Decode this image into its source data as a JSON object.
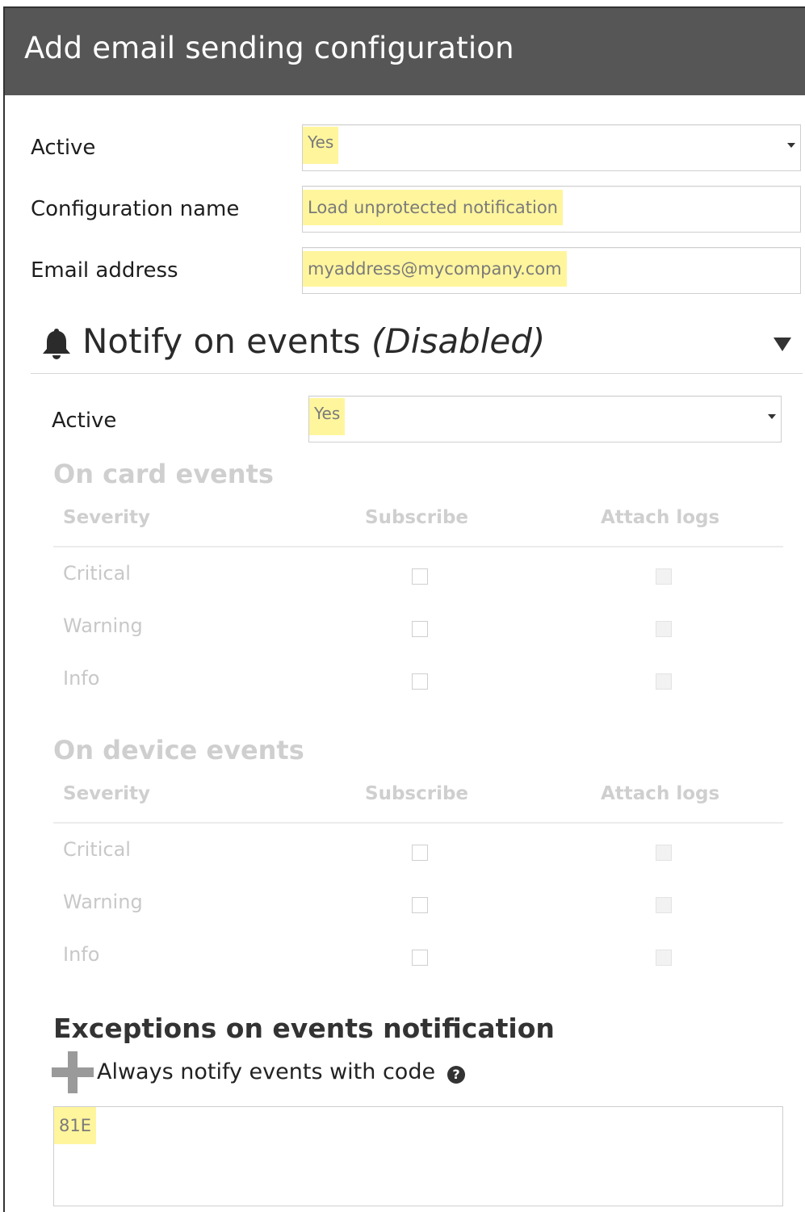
{
  "dialog": {
    "title": "Add email sending configuration"
  },
  "form": {
    "active_label": "Active",
    "active_value": "Yes",
    "config_name_label": "Configuration name",
    "config_name_value": "Load unprotected notification",
    "email_label": "Email address",
    "email_value": "myaddress@mycompany.com"
  },
  "notify": {
    "title": "Notify on events",
    "status": "(Disabled)",
    "bell_icon": "bell-icon",
    "collapse_icon": "triangle-down-icon",
    "active_label": "Active",
    "active_value": "Yes",
    "card_events": {
      "title": "On card events",
      "columns": [
        "Severity",
        "Subscribe",
        "Attach logs"
      ],
      "rows": [
        {
          "severity": "Critical",
          "subscribe": false,
          "attach_logs": false
        },
        {
          "severity": "Warning",
          "subscribe": false,
          "attach_logs": false
        },
        {
          "severity": "Info",
          "subscribe": false,
          "attach_logs": false
        }
      ]
    },
    "device_events": {
      "title": "On device events",
      "columns": [
        "Severity",
        "Subscribe",
        "Attach logs"
      ],
      "rows": [
        {
          "severity": "Critical",
          "subscribe": false,
          "attach_logs": false
        },
        {
          "severity": "Warning",
          "subscribe": false,
          "attach_logs": false
        },
        {
          "severity": "Info",
          "subscribe": false,
          "attach_logs": false
        }
      ]
    }
  },
  "exceptions": {
    "title": "Exceptions on events notification",
    "add_icon": "plus-icon",
    "always_notify_label": "Always notify events with code",
    "help_icon": "question-circle-icon",
    "help_glyph": "?",
    "codes_value": "81E"
  },
  "colors": {
    "titlebar_bg": "#565656",
    "highlight": "#fff59d",
    "disabled_text": "#cfcfcf"
  }
}
